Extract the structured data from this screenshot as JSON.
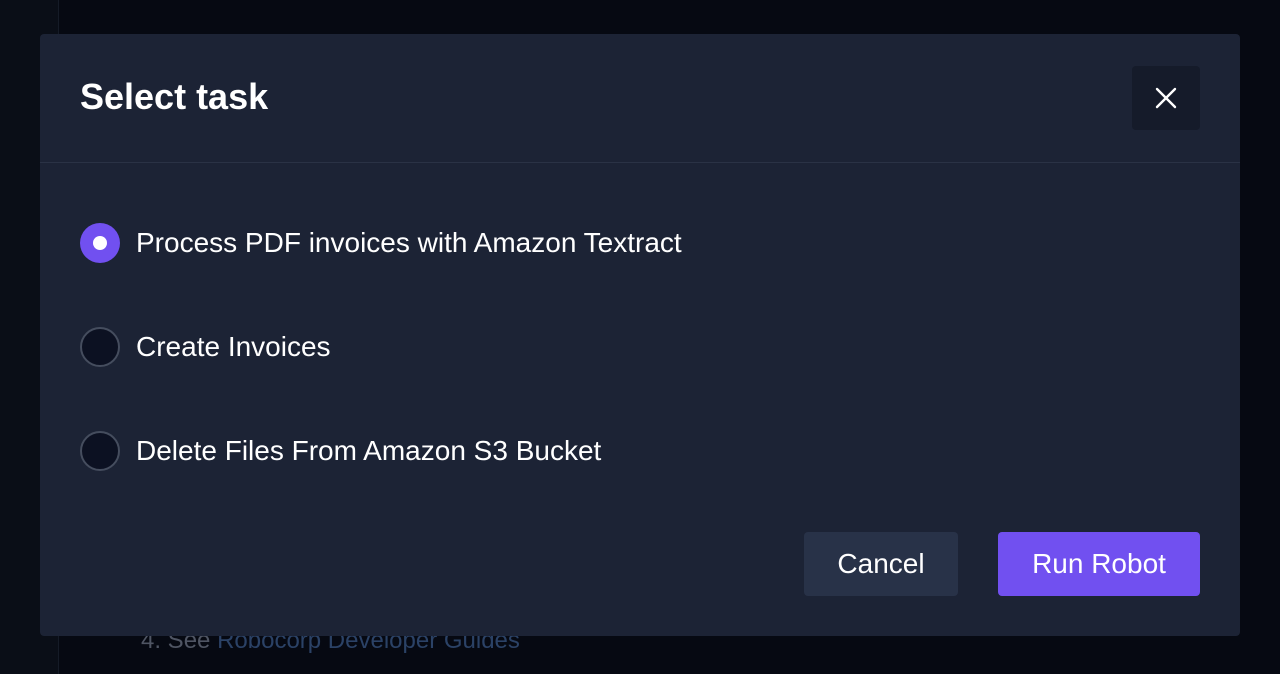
{
  "backdrop": {
    "list_item_prefix": "4. See ",
    "list_item_link": "Robocorp Developer Guides"
  },
  "modal": {
    "title": "Select task",
    "close_icon": "close-icon",
    "options": [
      {
        "label": "Process PDF invoices with Amazon Textract",
        "selected": true
      },
      {
        "label": "Create Invoices",
        "selected": false
      },
      {
        "label": "Delete Files From Amazon S3 Bucket",
        "selected": false
      }
    ],
    "cancel_label": "Cancel",
    "run_label": "Run Robot"
  },
  "colors": {
    "accent": "#7150f0",
    "modal_bg": "#1c2335",
    "backdrop": "#060912"
  }
}
